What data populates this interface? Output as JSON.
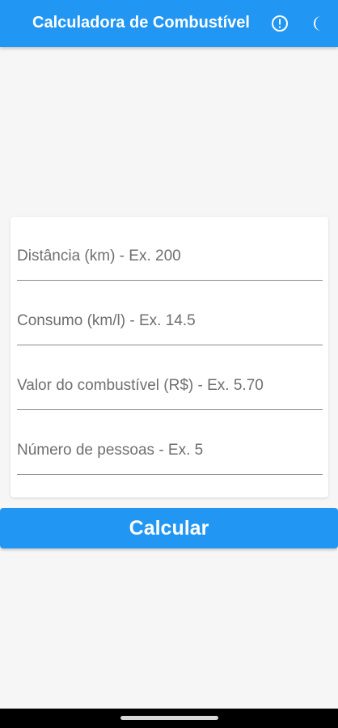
{
  "app_bar": {
    "title": "Calculadora de Combustível",
    "background_color": "#2196F3",
    "actions": [
      {
        "icon": "info-outline-icon"
      },
      {
        "icon": "moon-icon"
      }
    ]
  },
  "form": {
    "fields": [
      {
        "placeholder": "Distância (km) - Ex. 200",
        "value": ""
      },
      {
        "placeholder": "Consumo (km/l) - Ex. 14.5",
        "value": ""
      },
      {
        "placeholder": "Valor do combustível (R$) - Ex. 5.70",
        "value": ""
      },
      {
        "placeholder": "Número de pessoas - Ex. 5",
        "value": ""
      }
    ]
  },
  "calculate_button": {
    "label": "Calcular",
    "color": "#2196F3"
  },
  "system_nav": {
    "type": "gesture-bar"
  }
}
